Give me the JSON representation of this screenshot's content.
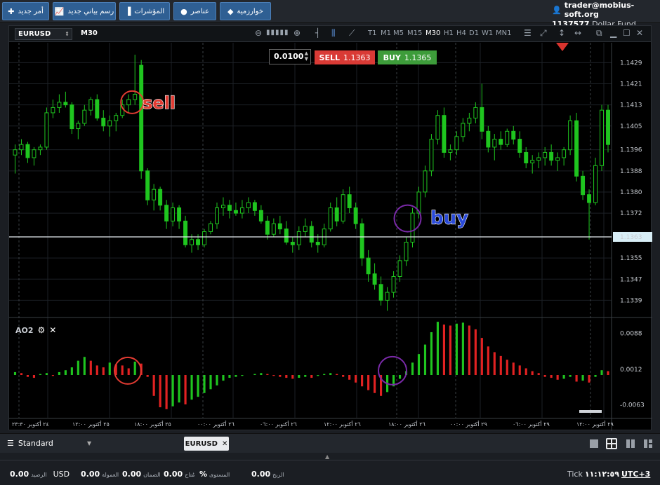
{
  "toolbar": {
    "new_order": "أمر جديد",
    "new_chart": "رسم بياني جديد",
    "indicators": "المؤشرات",
    "objects": "عناصر",
    "algorithms": "خوارزمية"
  },
  "account": {
    "user": "trader@mobius-soft.org",
    "number": "1137577",
    "fund": "Dollar Fund"
  },
  "chart": {
    "symbol": "EURUSD",
    "timeframe": "M30",
    "timeframes": [
      "T1",
      "M1",
      "M5",
      "M15",
      "M30",
      "H1",
      "H4",
      "D1",
      "W1",
      "MN1"
    ],
    "active_timeframe": "M30",
    "lot": "0.0100",
    "sell_label": "SELL",
    "sell_price": "1.1363",
    "buy_label": "BUY",
    "buy_price": "1.1365",
    "price_labels": [
      "1.1429",
      "1.1421",
      "1.1413",
      "1.1405",
      "1.1396",
      "1.1388",
      "1.1380",
      "1.1372",
      "1.1363",
      "1.1355",
      "1.1347",
      "1.1339"
    ],
    "current_price": "1.1363",
    "ao_name": "AO2",
    "ao_labels": [
      "0.0088",
      "0.0012",
      "-0.0063"
    ],
    "time_labels": [
      "٢٤ أكتوبر ٢٣:٣٠",
      "٢٥ أكتوبر ١٢:٠٠",
      "٢٥ أكتوبر ١٨:٠٠",
      "٢٦ أكتوبر ٠٠:٠٠",
      "٢٦ أكتوبر ٠٦:٠٠",
      "٢٦ أكتوبر ١٢:٠٠",
      "٢٦ أكتوبر ١٨:٠٠",
      "٢٩ أكتوبر ٠٠:٠٠",
      "٢٩ أكتوبر ٠٦:٠٠",
      "٢٩ أكتوبر ١٢:٠٠"
    ],
    "annotation_sell": "sell",
    "annotation_buy": "buy"
  },
  "chart_data": {
    "type": "candlestick",
    "y_range": [
      1.1333,
      1.1436
    ],
    "ohlc": [
      [
        1.1394,
        1.1398,
        1.1387,
        1.1396
      ],
      [
        1.1396,
        1.14,
        1.1394,
        1.1398
      ],
      [
        1.1398,
        1.1399,
        1.1391,
        1.1393
      ],
      [
        1.1393,
        1.1397,
        1.139,
        1.1396
      ],
      [
        1.1396,
        1.1398,
        1.1394,
        1.1397
      ],
      [
        1.1397,
        1.1412,
        1.1396,
        1.141
      ],
      [
        1.141,
        1.1415,
        1.1408,
        1.1412
      ],
      [
        1.1412,
        1.1417,
        1.141,
        1.1414
      ],
      [
        1.1414,
        1.1418,
        1.1412,
        1.1413
      ],
      [
        1.1413,
        1.1414,
        1.1402,
        1.1404
      ],
      [
        1.1404,
        1.1407,
        1.14,
        1.1406
      ],
      [
        1.1406,
        1.1413,
        1.1405,
        1.1411
      ],
      [
        1.1411,
        1.1416,
        1.1409,
        1.1415
      ],
      [
        1.1415,
        1.1417,
        1.1407,
        1.1408
      ],
      [
        1.1408,
        1.1411,
        1.1403,
        1.1405
      ],
      [
        1.1405,
        1.1409,
        1.1401,
        1.1407
      ],
      [
        1.1407,
        1.141,
        1.1403,
        1.1409
      ],
      [
        1.1409,
        1.1415,
        1.1408,
        1.1413
      ],
      [
        1.1413,
        1.1417,
        1.141,
        1.1415
      ],
      [
        1.1415,
        1.1432,
        1.1413,
        1.1417
      ],
      [
        1.1428,
        1.143,
        1.1385,
        1.1388
      ],
      [
        1.1388,
        1.1389,
        1.1375,
        1.1377
      ],
      [
        1.1377,
        1.1383,
        1.1373,
        1.1381
      ],
      [
        1.1381,
        1.1382,
        1.1373,
        1.1375
      ],
      [
        1.1375,
        1.1377,
        1.1366,
        1.1369
      ],
      [
        1.1369,
        1.1376,
        1.1367,
        1.1374
      ],
      [
        1.1374,
        1.1375,
        1.1366,
        1.1369
      ],
      [
        1.1369,
        1.1371,
        1.1359,
        1.136
      ],
      [
        1.136,
        1.1364,
        1.1357,
        1.1362
      ],
      [
        1.1362,
        1.1364,
        1.1358,
        1.136
      ],
      [
        1.136,
        1.1366,
        1.1359,
        1.1365
      ],
      [
        1.1365,
        1.1369,
        1.1364,
        1.1368
      ],
      [
        1.1368,
        1.1376,
        1.1366,
        1.1374
      ],
      [
        1.1374,
        1.1378,
        1.1371,
        1.1375
      ],
      [
        1.1375,
        1.1377,
        1.137,
        1.1373
      ],
      [
        1.1373,
        1.1376,
        1.1371,
        1.1372
      ],
      [
        1.1372,
        1.1377,
        1.137,
        1.1374
      ],
      [
        1.1374,
        1.1378,
        1.1372,
        1.1376
      ],
      [
        1.1376,
        1.1377,
        1.1371,
        1.1373
      ],
      [
        1.1373,
        1.1375,
        1.1368,
        1.1369
      ],
      [
        1.1369,
        1.1371,
        1.1362,
        1.1364
      ],
      [
        1.1364,
        1.137,
        1.1363,
        1.1368
      ],
      [
        1.1368,
        1.1371,
        1.1364,
        1.1366
      ],
      [
        1.1366,
        1.1369,
        1.136,
        1.1361
      ],
      [
        1.1361,
        1.1363,
        1.1357,
        1.136
      ],
      [
        1.136,
        1.1367,
        1.1358,
        1.1365
      ],
      [
        1.1365,
        1.137,
        1.1363,
        1.1367
      ],
      [
        1.1367,
        1.1369,
        1.1359,
        1.1361
      ],
      [
        1.1361,
        1.1364,
        1.1357,
        1.136
      ],
      [
        1.136,
        1.1368,
        1.1359,
        1.1366
      ],
      [
        1.1366,
        1.1376,
        1.1365,
        1.1374
      ],
      [
        1.1374,
        1.1378,
        1.1367,
        1.1369
      ],
      [
        1.1369,
        1.1381,
        1.1368,
        1.1379
      ],
      [
        1.1379,
        1.1382,
        1.1372,
        1.1374
      ],
      [
        1.1374,
        1.1376,
        1.1366,
        1.1368
      ],
      [
        1.1368,
        1.137,
        1.1352,
        1.1355
      ],
      [
        1.1355,
        1.1358,
        1.1346,
        1.1349
      ],
      [
        1.1349,
        1.1353,
        1.1343,
        1.1345
      ],
      [
        1.1345,
        1.1348,
        1.1337,
        1.1339
      ],
      [
        1.1339,
        1.1344,
        1.1335,
        1.1342
      ],
      [
        1.1342,
        1.135,
        1.134,
        1.1348
      ],
      [
        1.1348,
        1.1356,
        1.1346,
        1.1354
      ],
      [
        1.1354,
        1.1363,
        1.1352,
        1.1361
      ],
      [
        1.1361,
        1.1374,
        1.1359,
        1.1372
      ],
      [
        1.1372,
        1.1382,
        1.137,
        1.138
      ],
      [
        1.138,
        1.139,
        1.1378,
        1.1388
      ],
      [
        1.1388,
        1.1402,
        1.1386,
        1.14
      ],
      [
        1.14,
        1.1411,
        1.1398,
        1.1409
      ],
      [
        1.1409,
        1.1412,
        1.1393,
        1.1395
      ],
      [
        1.1395,
        1.1398,
        1.1392,
        1.1396
      ],
      [
        1.1396,
        1.1403,
        1.1394,
        1.1401
      ],
      [
        1.1401,
        1.1408,
        1.1399,
        1.1406
      ],
      [
        1.1406,
        1.141,
        1.1403,
        1.1408
      ],
      [
        1.1408,
        1.1414,
        1.1406,
        1.1412
      ],
      [
        1.1412,
        1.1421,
        1.14,
        1.1403
      ],
      [
        1.1403,
        1.1405,
        1.1395,
        1.1397
      ],
      [
        1.1397,
        1.1402,
        1.1392,
        1.14
      ],
      [
        1.14,
        1.1403,
        1.1396,
        1.1398
      ],
      [
        1.1398,
        1.1404,
        1.1397,
        1.1403
      ],
      [
        1.1403,
        1.1405,
        1.1398,
        1.14
      ],
      [
        1.14,
        1.1403,
        1.1393,
        1.1395
      ],
      [
        1.1395,
        1.1397,
        1.1389,
        1.1391
      ],
      [
        1.1391,
        1.1394,
        1.1387,
        1.1392
      ],
      [
        1.1392,
        1.1395,
        1.1389,
        1.1393
      ],
      [
        1.1393,
        1.1397,
        1.139,
        1.1395
      ],
      [
        1.1395,
        1.1398,
        1.139,
        1.1392
      ],
      [
        1.1392,
        1.1395,
        1.1388,
        1.1393
      ],
      [
        1.1393,
        1.1397,
        1.139,
        1.1396
      ],
      [
        1.1396,
        1.1409,
        1.1394,
        1.1407
      ],
      [
        1.1407,
        1.141,
        1.1384,
        1.1386
      ],
      [
        1.1386,
        1.1388,
        1.1377,
        1.1379
      ],
      [
        1.1379,
        1.1381,
        1.1362,
        1.1376
      ],
      [
        1.1376,
        1.1393,
        1.1375,
        1.139
      ],
      [
        1.139,
        1.1413,
        1.1388,
        1.1411
      ],
      [
        1.1411,
        1.1413,
        1.1395,
        1.1398
      ]
    ],
    "ao": [
      0.0006,
      0.0004,
      -0.0004,
      -0.0006,
      0.0002,
      0.0004,
      -0.0002,
      0.0006,
      0.001,
      0.0016,
      0.003,
      0.0038,
      0.003,
      0.002,
      0.0016,
      0.0026,
      0.0022,
      0.002,
      0.0014,
      0.0028,
      0.0024,
      -0.0004,
      -0.0044,
      -0.0068,
      -0.0072,
      -0.0066,
      -0.0058,
      -0.0062,
      -0.0052,
      -0.0046,
      -0.0038,
      -0.003,
      -0.0022,
      -0.0012,
      -0.0006,
      -0.0004,
      -0.0002,
      0.0,
      0.0002,
      0.0004,
      0.0002,
      -0.0002,
      -0.0004,
      -0.0006,
      -0.0008,
      -0.0006,
      -0.0004,
      -0.0006,
      -0.0002,
      0.0002,
      0.0004,
      0.0002,
      -0.0004,
      -0.001,
      -0.0016,
      -0.0024,
      -0.0032,
      -0.0038,
      -0.0044,
      -0.0036,
      -0.0024,
      -0.0008,
      0.0008,
      0.0026,
      0.0044,
      0.0064,
      0.009,
      0.0112,
      0.0106,
      0.0104,
      0.0108,
      0.011,
      0.0104,
      0.0096,
      0.0078,
      0.006,
      0.0048,
      0.004,
      0.0032,
      0.0026,
      0.002,
      0.0014,
      0.0008,
      0.0004,
      -0.0004,
      -0.0006,
      -0.001,
      -0.0008,
      -0.0004,
      -0.0014,
      -0.0012,
      -0.0016,
      -0.0004,
      0.001,
      0.0008
    ],
    "ao_range": [
      -0.009,
      0.0118
    ],
    "hline": 1.1363
  },
  "tabs": {
    "profile": "Standard",
    "symbol_tab": "EURUSD"
  },
  "status": {
    "balance_label": "الرصيد",
    "balance": "0.00",
    "currency": "USD",
    "commission_label": "العمولة",
    "commission": "0.00",
    "margin_label": "الضمان",
    "margin": "0.00",
    "free_label": "مُتاح",
    "free": "0.00",
    "level_label": "المستوى",
    "level": "%",
    "profit_label": "الربح",
    "profit": "0.00",
    "tick_label": "Tick",
    "time": "١١:١٢:٥٩",
    "tz": "UTC+3"
  }
}
